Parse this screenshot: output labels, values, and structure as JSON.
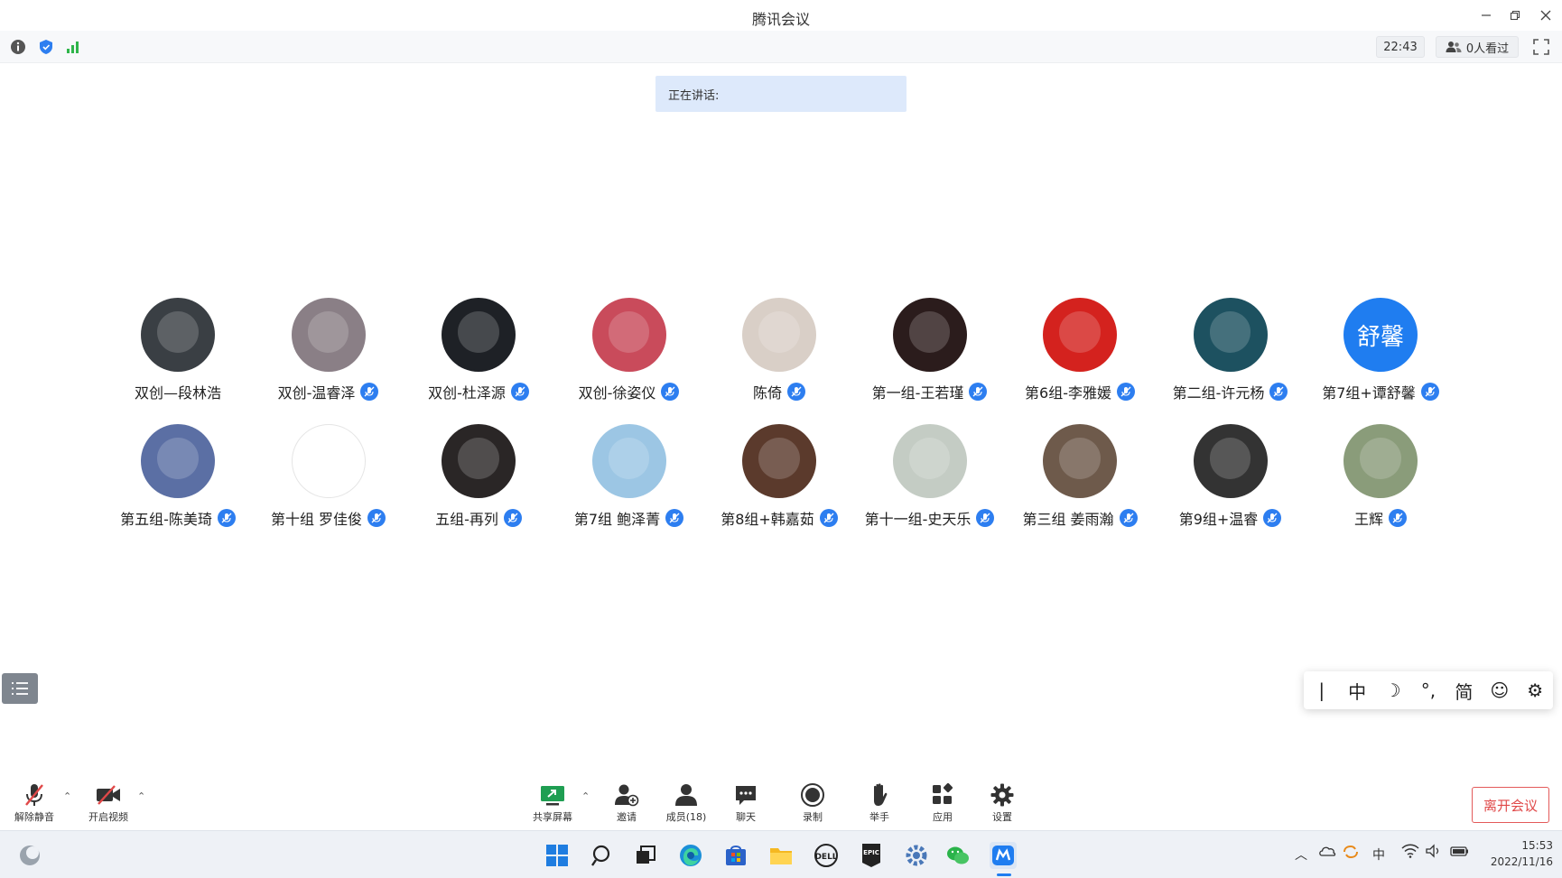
{
  "window": {
    "title": "腾讯会议"
  },
  "infobar": {
    "duration": "22:43",
    "viewers": "0人看过"
  },
  "speaking": {
    "label": "正在讲话:"
  },
  "participants": [
    {
      "name": "双创—段林浩",
      "mic": false,
      "color": "#3a3f44"
    },
    {
      "name": "双创-温睿泽",
      "mic": true,
      "color": "#8a7f86"
    },
    {
      "name": "双创-杜泽源",
      "mic": true,
      "color": "#1e2126"
    },
    {
      "name": "双创-徐姿仪",
      "mic": true,
      "color": "#c94b5b"
    },
    {
      "name": "陈倚",
      "mic": true,
      "color": "#d9cfc7"
    },
    {
      "name": "第一组-王若瑾",
      "mic": true,
      "color": "#2b1c1c"
    },
    {
      "name": "第6组-李雅媛",
      "mic": true,
      "color": "#d4221e"
    },
    {
      "name": "第二组-许元杨",
      "mic": true,
      "color": "#1d5160"
    },
    {
      "name": "第7组+谭舒馨",
      "mic": true,
      "color": "#1f7df0",
      "initials": "舒馨"
    },
    {
      "name": "第五组-陈美琦",
      "mic": true,
      "color": "#5b6fa4"
    },
    {
      "name": "第十组 罗佳俊",
      "mic": true,
      "color": "#ffffff"
    },
    {
      "name": "五组-再列",
      "mic": true,
      "color": "#2a2626"
    },
    {
      "name": "第7组 鲍泽菁",
      "mic": true,
      "color": "#9cc6e4"
    },
    {
      "name": "第8组+韩嘉茹",
      "mic": true,
      "color": "#5b3a2c"
    },
    {
      "name": "第十一组-史天乐",
      "mic": true,
      "color": "#c4ccc4"
    },
    {
      "name": "第三组 姜雨瀚",
      "mic": true,
      "color": "#6e5a4b"
    },
    {
      "name": "第9组+温睿",
      "mic": true,
      "color": "#333333"
    },
    {
      "name": "王辉",
      "mic": true,
      "color": "#8a9c7a"
    }
  ],
  "ime": {
    "items": [
      "|",
      "中",
      "☽",
      "°,",
      "简",
      "☺",
      "⚙"
    ]
  },
  "toolbar": {
    "unmute": "解除静音",
    "start_video": "开启视频",
    "share": "共享屏幕",
    "invite": "邀请",
    "members": "成员(18)",
    "chat": "聊天",
    "record": "录制",
    "raise_hand": "举手",
    "apps": "应用",
    "settings": "设置",
    "leave": "离开会议"
  },
  "taskbar": {
    "ime_indicator": "中",
    "time": "15:53",
    "date": "2022/11/16"
  },
  "colors": {
    "accent": "#2d7ef0",
    "leave": "#e04848",
    "speaking_bg": "#dde9fb"
  }
}
